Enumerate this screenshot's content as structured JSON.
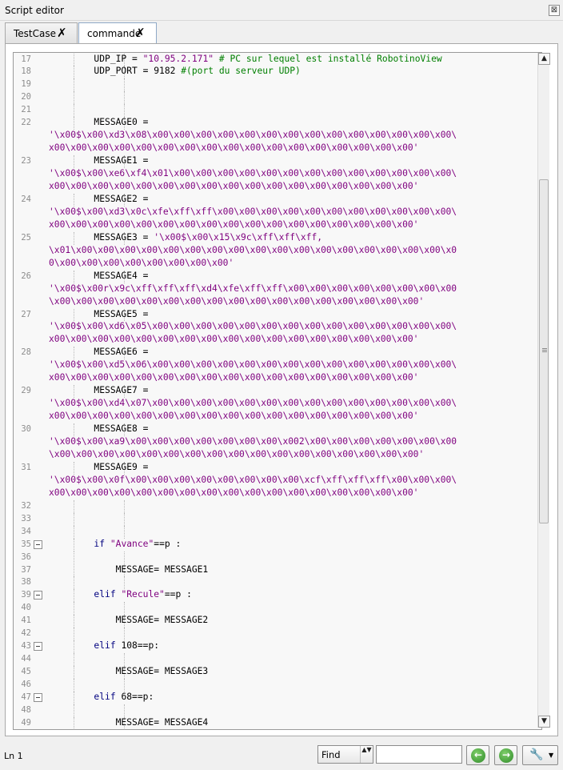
{
  "window": {
    "title": "Script editor",
    "close_glyph": "⊠",
    "close_icon": "window-close-icon"
  },
  "tabs": [
    {
      "label": "TestCase",
      "active": false,
      "close_glyph": "✗"
    },
    {
      "label": "commande",
      "active": true,
      "close_glyph": "✗"
    }
  ],
  "code_lines": [
    {
      "num": "17",
      "guides": 2,
      "segments": [
        {
          "t": "        UDP_IP = ",
          "c": ""
        },
        {
          "t": "\"10.95.2.171\"",
          "c": "str"
        },
        {
          "t": " # PC sur lequel est installé RobotinoView",
          "c": "cmt"
        }
      ]
    },
    {
      "num": "18",
      "guides": 2,
      "segments": [
        {
          "t": "        UDP_PORT = 9182 ",
          "c": ""
        },
        {
          "t": "#(port du serveur UDP)",
          "c": "cmt"
        }
      ]
    },
    {
      "num": "19",
      "guides": 2,
      "segments": []
    },
    {
      "num": "20",
      "guides": 2,
      "segments": []
    },
    {
      "num": "21",
      "guides": 2,
      "segments": []
    },
    {
      "num": "22",
      "guides": 2,
      "segments": [
        {
          "t": "        MESSAGE0 =",
          "c": ""
        }
      ]
    },
    {
      "num": "",
      "guides": 0,
      "segments": [
        {
          "t": "'\\x00$\\x00\\xd3\\x08\\x00\\x00\\x00\\x00\\x00\\x00\\x00\\x00\\x00\\x00\\x00\\x00\\x00\\x00\\",
          "c": "str"
        }
      ]
    },
    {
      "num": "",
      "guides": 0,
      "segments": [
        {
          "t": "x00\\x00\\x00\\x00\\x00\\x00\\x00\\x00\\x00\\x00\\x00\\x00\\x00\\x00\\x00\\x00\\x00'",
          "c": "str"
        }
      ]
    },
    {
      "num": "23",
      "guides": 2,
      "segments": [
        {
          "t": "        MESSAGE1 =",
          "c": ""
        }
      ]
    },
    {
      "num": "",
      "guides": 0,
      "segments": [
        {
          "t": "'\\x00$\\x00\\xe6\\xf4\\x01\\x00\\x00\\x00\\x00\\x00\\x00\\x00\\x00\\x00\\x00\\x00\\x00\\x00\\",
          "c": "str"
        }
      ]
    },
    {
      "num": "",
      "guides": 0,
      "segments": [
        {
          "t": "x00\\x00\\x00\\x00\\x00\\x00\\x00\\x00\\x00\\x00\\x00\\x00\\x00\\x00\\x00\\x00\\x00'",
          "c": "str"
        }
      ]
    },
    {
      "num": "24",
      "guides": 2,
      "segments": [
        {
          "t": "        MESSAGE2 =",
          "c": ""
        }
      ]
    },
    {
      "num": "",
      "guides": 0,
      "segments": [
        {
          "t": "'\\x00$\\x00\\xd3\\x0c\\xfe\\xff\\xff\\x00\\x00\\x00\\x00\\x00\\x00\\x00\\x00\\x00\\x00\\x00\\",
          "c": "str"
        }
      ]
    },
    {
      "num": "",
      "guides": 0,
      "segments": [
        {
          "t": "x00\\x00\\x00\\x00\\x00\\x00\\x00\\x00\\x00\\x00\\x00\\x00\\x00\\x00\\x00\\x00\\x00'",
          "c": "str"
        }
      ]
    },
    {
      "num": "25",
      "guides": 2,
      "segments": [
        {
          "t": "        MESSAGE3 = ",
          "c": ""
        },
        {
          "t": "'\\x00$\\x00\\x15\\x9c\\xff\\xff\\xff,",
          "c": "str"
        }
      ]
    },
    {
      "num": "",
      "guides": 0,
      "segments": [
        {
          "t": "\\x01\\x00\\x00\\x00\\x00\\x00\\x00\\x00\\x00\\x00\\x00\\x00\\x00\\x00\\x00\\x00\\x00\\x00\\x0",
          "c": "str"
        }
      ]
    },
    {
      "num": "",
      "guides": 0,
      "segments": [
        {
          "t": "0\\x00\\x00\\x00\\x00\\x00\\x00\\x00\\x00'",
          "c": "str"
        }
      ]
    },
    {
      "num": "26",
      "guides": 2,
      "segments": [
        {
          "t": "        MESSAGE4 =",
          "c": ""
        }
      ]
    },
    {
      "num": "",
      "guides": 0,
      "segments": [
        {
          "t": "'\\x00$\\x00r\\x9c\\xff\\xff\\xff\\xd4\\xfe\\xff\\xff\\x00\\x00\\x00\\x00\\x00\\x00\\x00\\x00",
          "c": "str"
        }
      ]
    },
    {
      "num": "",
      "guides": 0,
      "segments": [
        {
          "t": "\\x00\\x00\\x00\\x00\\x00\\x00\\x00\\x00\\x00\\x00\\x00\\x00\\x00\\x00\\x00\\x00\\x00'",
          "c": "str"
        }
      ]
    },
    {
      "num": "27",
      "guides": 2,
      "segments": [
        {
          "t": "        MESSAGE5 =",
          "c": ""
        }
      ]
    },
    {
      "num": "",
      "guides": 0,
      "segments": [
        {
          "t": "'\\x00$\\x00\\xd6\\x05\\x00\\x00\\x00\\x00\\x00\\x00\\x00\\x00\\x00\\x00\\x00\\x00\\x00\\x00\\",
          "c": "str"
        }
      ]
    },
    {
      "num": "",
      "guides": 0,
      "segments": [
        {
          "t": "x00\\x00\\x00\\x00\\x00\\x00\\x00\\x00\\x00\\x00\\x00\\x00\\x00\\x00\\x00\\x00\\x00'",
          "c": "str"
        }
      ]
    },
    {
      "num": "28",
      "guides": 2,
      "segments": [
        {
          "t": "        MESSAGE6 =",
          "c": ""
        }
      ]
    },
    {
      "num": "",
      "guides": 0,
      "segments": [
        {
          "t": "'\\x00$\\x00\\xd5\\x06\\x00\\x00\\x00\\x00\\x00\\x00\\x00\\x00\\x00\\x00\\x00\\x00\\x00\\x00\\",
          "c": "str"
        }
      ]
    },
    {
      "num": "",
      "guides": 0,
      "segments": [
        {
          "t": "x00\\x00\\x00\\x00\\x00\\x00\\x00\\x00\\x00\\x00\\x00\\x00\\x00\\x00\\x00\\x00\\x00'",
          "c": "str"
        }
      ]
    },
    {
      "num": "29",
      "guides": 2,
      "segments": [
        {
          "t": "        MESSAGE7 =",
          "c": ""
        }
      ]
    },
    {
      "num": "",
      "guides": 0,
      "segments": [
        {
          "t": "'\\x00$\\x00\\xd4\\x07\\x00\\x00\\x00\\x00\\x00\\x00\\x00\\x00\\x00\\x00\\x00\\x00\\x00\\x00\\",
          "c": "str"
        }
      ]
    },
    {
      "num": "",
      "guides": 0,
      "segments": [
        {
          "t": "x00\\x00\\x00\\x00\\x00\\x00\\x00\\x00\\x00\\x00\\x00\\x00\\x00\\x00\\x00\\x00\\x00'",
          "c": "str"
        }
      ]
    },
    {
      "num": "30",
      "guides": 2,
      "segments": [
        {
          "t": "        MESSAGE8 =",
          "c": ""
        }
      ]
    },
    {
      "num": "",
      "guides": 0,
      "segments": [
        {
          "t": "'\\x00$\\x00\\xa9\\x00\\x00\\x00\\x00\\x00\\x00\\x00\\x002\\x00\\x00\\x00\\x00\\x00\\x00\\x00",
          "c": "str"
        }
      ]
    },
    {
      "num": "",
      "guides": 0,
      "segments": [
        {
          "t": "\\x00\\x00\\x00\\x00\\x00\\x00\\x00\\x00\\x00\\x00\\x00\\x00\\x00\\x00\\x00\\x00\\x00'",
          "c": "str"
        }
      ]
    },
    {
      "num": "31",
      "guides": 2,
      "segments": [
        {
          "t": "        MESSAGE9 =",
          "c": ""
        }
      ]
    },
    {
      "num": "",
      "guides": 0,
      "segments": [
        {
          "t": "'\\x00$\\x00\\x0f\\x00\\x00\\x00\\x00\\x00\\x00\\x00\\x00\\xcf\\xff\\xff\\xff\\x00\\x00\\x00\\",
          "c": "str"
        }
      ]
    },
    {
      "num": "",
      "guides": 0,
      "segments": [
        {
          "t": "x00\\x00\\x00\\x00\\x00\\x00\\x00\\x00\\x00\\x00\\x00\\x00\\x00\\x00\\x00\\x00\\x00'",
          "c": "str"
        }
      ]
    },
    {
      "num": "32",
      "guides": 2,
      "segments": []
    },
    {
      "num": "33",
      "guides": 2,
      "segments": []
    },
    {
      "num": "34",
      "guides": 2,
      "segments": []
    },
    {
      "num": "35",
      "guides": 1,
      "fold": true,
      "segments": [
        {
          "t": "        ",
          "c": ""
        },
        {
          "t": "if",
          "c": "kw"
        },
        {
          "t": " ",
          "c": ""
        },
        {
          "t": "\"Avance\"",
          "c": "str"
        },
        {
          "t": "==p :",
          "c": ""
        }
      ]
    },
    {
      "num": "36",
      "guides": 2,
      "segments": []
    },
    {
      "num": "37",
      "guides": 2,
      "segments": [
        {
          "t": "            MESSAGE= MESSAGE1",
          "c": ""
        }
      ]
    },
    {
      "num": "38",
      "guides": 2,
      "segments": []
    },
    {
      "num": "39",
      "guides": 1,
      "fold": true,
      "segments": [
        {
          "t": "        ",
          "c": ""
        },
        {
          "t": "elif",
          "c": "kw"
        },
        {
          "t": " ",
          "c": ""
        },
        {
          "t": "\"Recule\"",
          "c": "str"
        },
        {
          "t": "==p :",
          "c": ""
        }
      ]
    },
    {
      "num": "40",
      "guides": 2,
      "segments": []
    },
    {
      "num": "41",
      "guides": 2,
      "segments": [
        {
          "t": "            MESSAGE= MESSAGE2",
          "c": ""
        }
      ]
    },
    {
      "num": "42",
      "guides": 2,
      "segments": []
    },
    {
      "num": "43",
      "guides": 1,
      "fold": true,
      "segments": [
        {
          "t": "        ",
          "c": ""
        },
        {
          "t": "elif",
          "c": "kw"
        },
        {
          "t": " 108==p:",
          "c": ""
        }
      ]
    },
    {
      "num": "44",
      "guides": 2,
      "segments": []
    },
    {
      "num": "45",
      "guides": 2,
      "segments": [
        {
          "t": "            MESSAGE= MESSAGE3",
          "c": ""
        }
      ]
    },
    {
      "num": "46",
      "guides": 2,
      "segments": []
    },
    {
      "num": "47",
      "guides": 1,
      "fold": true,
      "segments": [
        {
          "t": "        ",
          "c": ""
        },
        {
          "t": "elif",
          "c": "kw"
        },
        {
          "t": " 68==p:",
          "c": ""
        }
      ]
    },
    {
      "num": "48",
      "guides": 2,
      "segments": []
    },
    {
      "num": "49",
      "guides": 2,
      "segments": [
        {
          "t": "            MESSAGE= MESSAGE4",
          "c": ""
        }
      ]
    }
  ],
  "scrollbar": {
    "up_glyph": "▲",
    "down_glyph": "▼"
  },
  "status": {
    "position_text": "Ln 1",
    "find_mode": "Find",
    "find_spin_glyph": "▲▼",
    "find_value": "",
    "find_placeholder": "",
    "prev_glyph": "←",
    "next_glyph": "→",
    "tools_glyph": "🔧",
    "tools_caret": "▼"
  },
  "colors": {
    "string": "#7f007f",
    "keyword": "#00007f",
    "comment": "#007f00",
    "line_number": "#8c8c8c",
    "editor_bg": "#f8f8f8"
  },
  "icons": {
    "tab_close": "close-icon",
    "fold": "fold-minus-icon",
    "prev": "arrow-left-circle-icon",
    "next": "arrow-right-circle-icon",
    "tools": "wrench-icon"
  }
}
